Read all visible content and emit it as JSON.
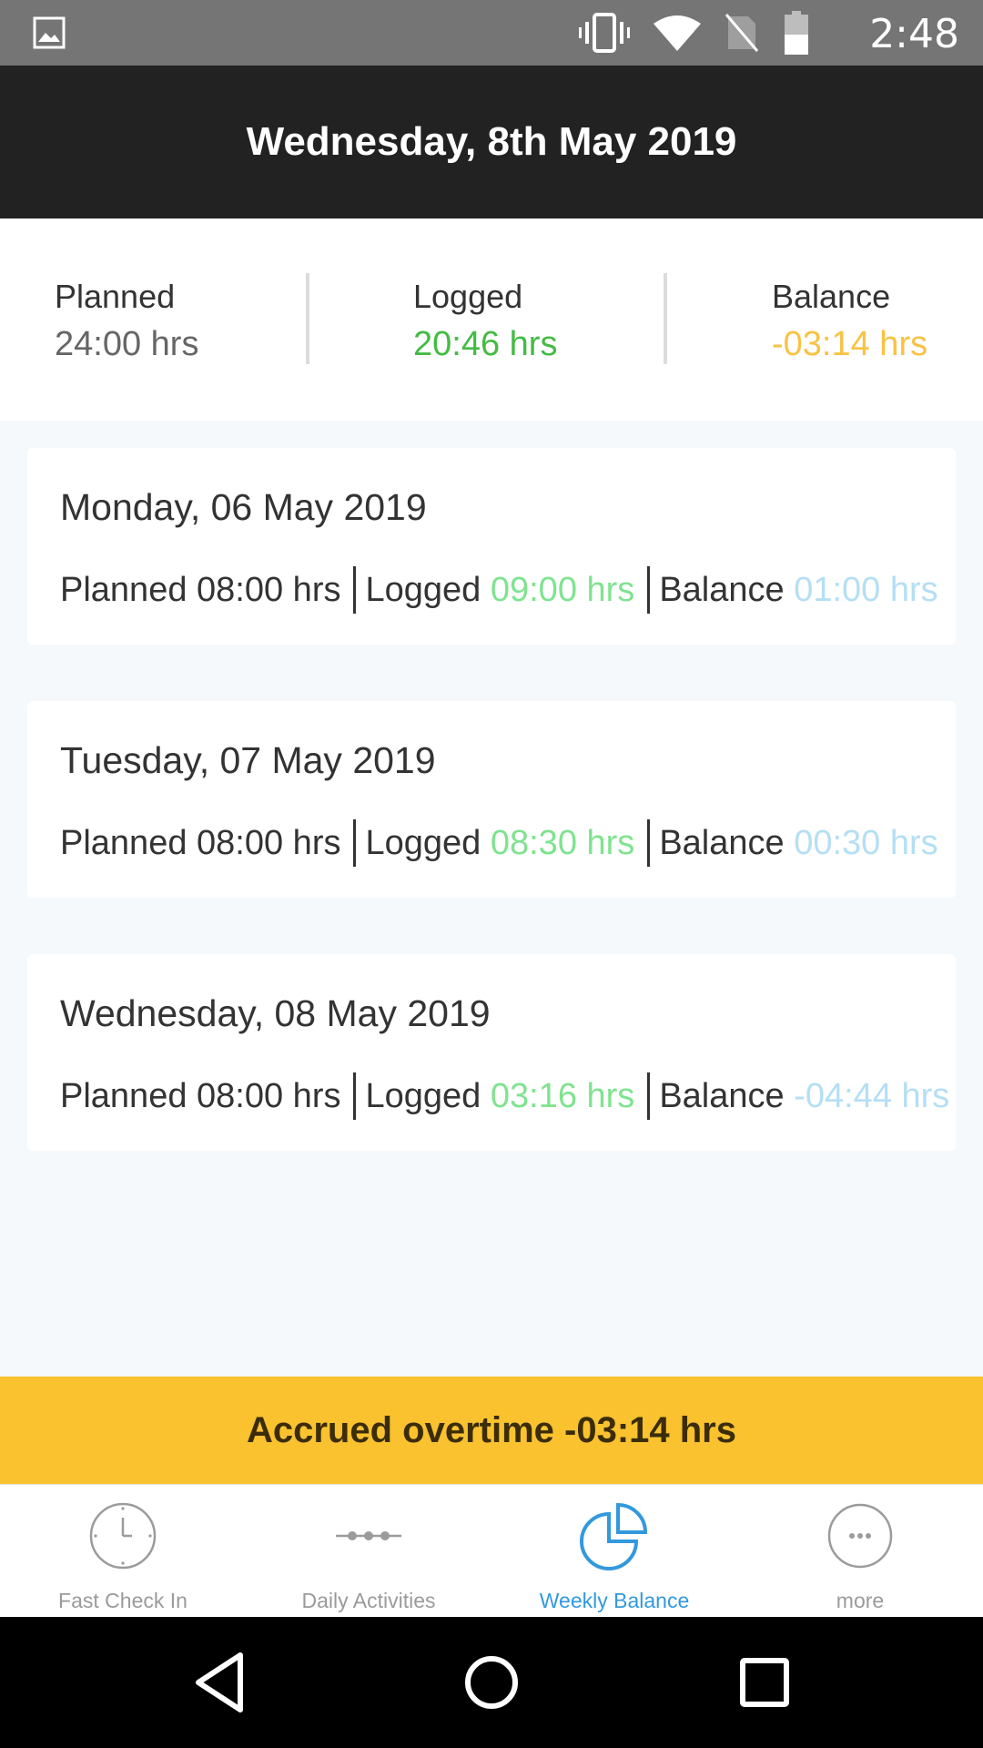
{
  "status_bar": {
    "time": "2:48",
    "icons": [
      "gallery-icon",
      "vibrate-icon",
      "wifi-icon",
      "no-sim-icon",
      "battery-icon"
    ]
  },
  "header": {
    "title": "Wednesday, 8th May 2019"
  },
  "summary": {
    "planned": {
      "label": "Planned",
      "value": "24:00 hrs"
    },
    "logged": {
      "label": "Logged",
      "value": "20:46 hrs"
    },
    "balance": {
      "label": "Balance",
      "value": "-03:14 hrs"
    }
  },
  "days": [
    {
      "date": "Monday, 06 May 2019",
      "planned_label": "Planned",
      "planned": "08:00 hrs",
      "logged_label": "Logged",
      "logged": "09:00 hrs",
      "balance_label": "Balance",
      "balance": "01:00 hrs"
    },
    {
      "date": "Tuesday, 07 May 2019",
      "planned_label": "Planned",
      "planned": "08:00 hrs",
      "logged_label": "Logged",
      "logged": "08:30 hrs",
      "balance_label": "Balance",
      "balance": "00:30 hrs"
    },
    {
      "date": "Wednesday, 08 May 2019",
      "planned_label": "Planned",
      "planned": "08:00 hrs",
      "logged_label": "Logged",
      "logged": "03:16 hrs",
      "balance_label": "Balance",
      "balance": "-04:44 hrs"
    }
  ],
  "accrued": {
    "text": "Accrued overtime -03:14 hrs"
  },
  "tabs": [
    {
      "label": "Fast Check In",
      "icon": "clock-icon",
      "active": false
    },
    {
      "label": "Daily Activities",
      "icon": "dots-line-icon",
      "active": false
    },
    {
      "label": "Weekly Balance",
      "icon": "pie-chart-icon",
      "active": true
    },
    {
      "label": "more",
      "icon": "more-icon",
      "active": false
    }
  ],
  "colors": {
    "header_bg": "#222222",
    "logged_green": "#44bb44",
    "balance_orange": "#f9c244",
    "accent_blue": "#3399dd",
    "accrued_bg": "#f9c22e"
  }
}
